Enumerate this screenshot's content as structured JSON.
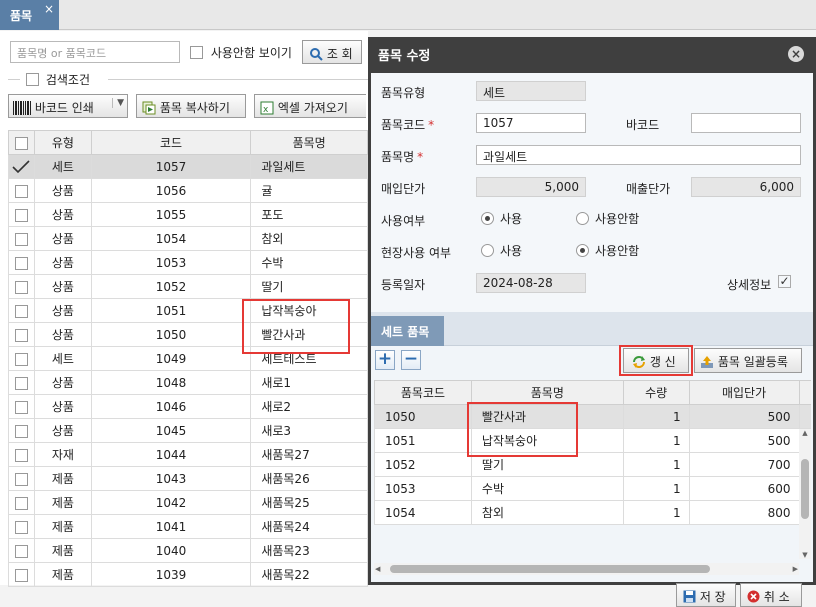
{
  "tab": {
    "title": "품목",
    "close": "×"
  },
  "left": {
    "search_placeholder": "품목명 or 품목코드",
    "show_unused_label": "사용안함 보이기",
    "search_button": "조 회",
    "conditions_label": "검색조건",
    "barcode_button": "바코드 인쇄",
    "copy_button": "품목 복사하기",
    "excel_button": "엑셀 가져오기",
    "columns": [
      "유형",
      "코드",
      "품목명"
    ],
    "rows": [
      {
        "type": "세트",
        "code": "1057",
        "name": "과일세트",
        "checked": true
      },
      {
        "type": "상품",
        "code": "1056",
        "name": "귤"
      },
      {
        "type": "상품",
        "code": "1055",
        "name": "포도"
      },
      {
        "type": "상품",
        "code": "1054",
        "name": "참외"
      },
      {
        "type": "상품",
        "code": "1053",
        "name": "수박"
      },
      {
        "type": "상품",
        "code": "1052",
        "name": "딸기"
      },
      {
        "type": "상품",
        "code": "1051",
        "name": "납작복숭아"
      },
      {
        "type": "상품",
        "code": "1050",
        "name": "빨간사과"
      },
      {
        "type": "세트",
        "code": "1049",
        "name": "세트테스트"
      },
      {
        "type": "상품",
        "code": "1048",
        "name": "새로1"
      },
      {
        "type": "상품",
        "code": "1046",
        "name": "새로2"
      },
      {
        "type": "상품",
        "code": "1045",
        "name": "새로3"
      },
      {
        "type": "자재",
        "code": "1044",
        "name": "새품목27"
      },
      {
        "type": "제품",
        "code": "1043",
        "name": "새품목26"
      },
      {
        "type": "제품",
        "code": "1042",
        "name": "새품목25"
      },
      {
        "type": "제품",
        "code": "1041",
        "name": "새품목24"
      },
      {
        "type": "제품",
        "code": "1040",
        "name": "새품목23"
      },
      {
        "type": "제품",
        "code": "1039",
        "name": "새품목22"
      }
    ]
  },
  "dialog": {
    "title": "품목 수정",
    "labels": {
      "item_type": "품목유형",
      "item_code": "품목코드",
      "barcode": "바코드",
      "item_name": "품목명",
      "purchase_price": "매입단가",
      "sale_price": "매출단가",
      "use_status": "사용여부",
      "site_use": "현장사용 여부",
      "reg_date": "등록일자",
      "detail_info": "상세정보"
    },
    "required_mark": "*",
    "values": {
      "item_type": "세트",
      "item_code": "1057",
      "barcode": "",
      "item_name": "과일세트",
      "purchase_price": "5,000",
      "sale_price": "6,000",
      "reg_date": "2024-08-28"
    },
    "radio": {
      "use": "사용",
      "unused": "사용안함"
    },
    "check_mark": "✓",
    "set_tab": "세트 품목",
    "plus": "+",
    "minus": "−",
    "refresh_button": "갱 신",
    "bulk_register_button": "품목 일괄등록",
    "set_columns": [
      "품목코드",
      "품목명",
      "수량",
      "매입단가"
    ],
    "set_rows": [
      {
        "code": "1050",
        "name": "빨간사과",
        "qty": "1",
        "price": "500"
      },
      {
        "code": "1051",
        "name": "납작복숭아",
        "qty": "1",
        "price": "500"
      },
      {
        "code": "1052",
        "name": "딸기",
        "qty": "1",
        "price": "700"
      },
      {
        "code": "1053",
        "name": "수박",
        "qty": "1",
        "price": "600"
      },
      {
        "code": "1054",
        "name": "참외",
        "qty": "1",
        "price": "800"
      }
    ],
    "save_button": "저 장",
    "cancel_button": "취 소"
  }
}
